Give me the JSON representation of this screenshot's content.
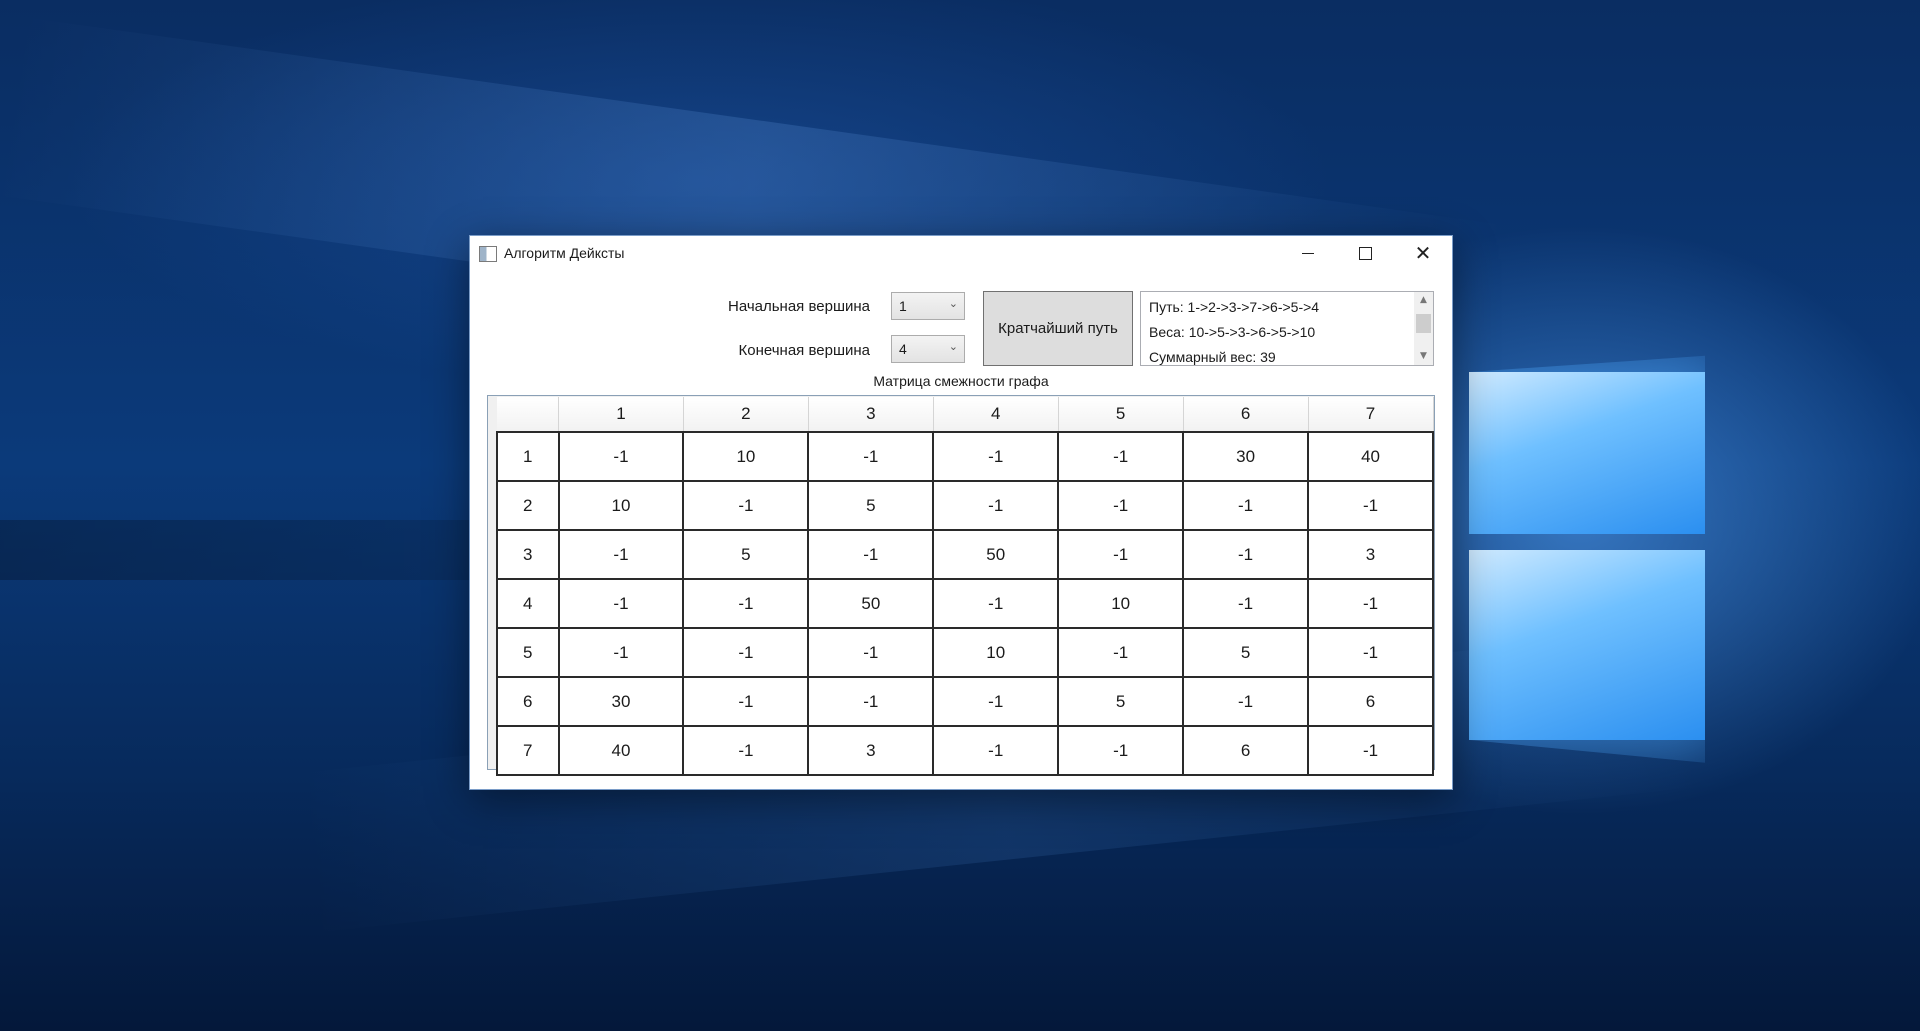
{
  "window": {
    "title": "Алгоритм Дейксты",
    "minimize_label": "—",
    "maximize_label": "□",
    "close_label": "✕"
  },
  "controls": {
    "start_label": "Начальная вершина",
    "start_value": "1",
    "end_label": "Конечная вершина",
    "end_value": "4",
    "button_label": "Кратчайший путь"
  },
  "result": {
    "path": "Путь: 1->2->3->7->6->5->4",
    "weights": "Веса: 10->5->3->6->5->10",
    "total": "Суммарный вес: 39"
  },
  "matrix": {
    "caption": "Матрица смежности графа",
    "headers": [
      "1",
      "2",
      "3",
      "4",
      "5",
      "6",
      "7"
    ],
    "rows": [
      {
        "label": "1",
        "cells": [
          "-1",
          "10",
          "-1",
          "-1",
          "-1",
          "30",
          "40"
        ]
      },
      {
        "label": "2",
        "cells": [
          "10",
          "-1",
          "5",
          "-1",
          "-1",
          "-1",
          "-1"
        ]
      },
      {
        "label": "3",
        "cells": [
          "-1",
          "5",
          "-1",
          "50",
          "-1",
          "-1",
          "3"
        ]
      },
      {
        "label": "4",
        "cells": [
          "-1",
          "-1",
          "50",
          "-1",
          "10",
          "-1",
          "-1"
        ]
      },
      {
        "label": "5",
        "cells": [
          "-1",
          "-1",
          "-1",
          "10",
          "-1",
          "5",
          "-1"
        ]
      },
      {
        "label": "6",
        "cells": [
          "30",
          "-1",
          "-1",
          "-1",
          "5",
          "-1",
          "6"
        ]
      },
      {
        "label": "7",
        "cells": [
          "40",
          "-1",
          "3",
          "-1",
          "-1",
          "6",
          "-1"
        ]
      }
    ]
  }
}
